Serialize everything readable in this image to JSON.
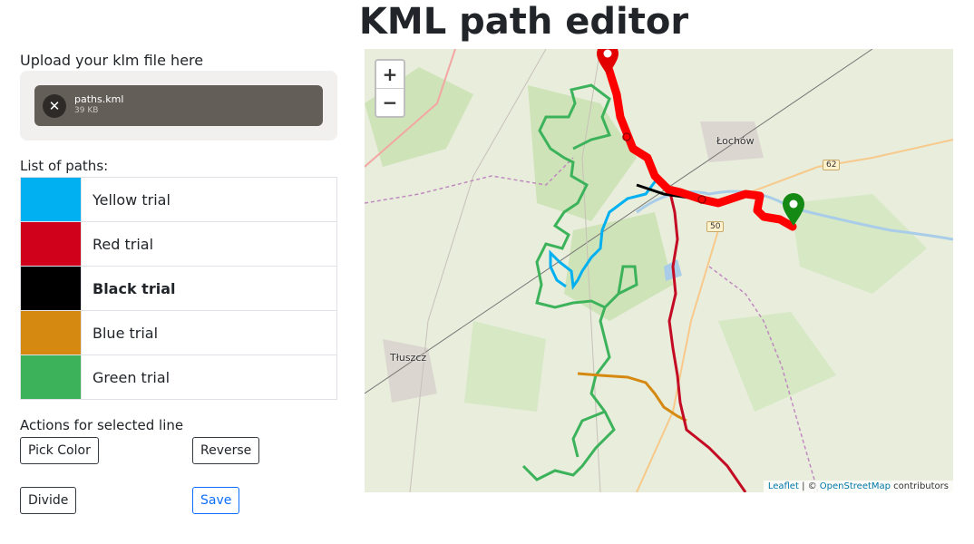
{
  "page": {
    "title": "KML path editor"
  },
  "upload": {
    "label": "Upload your klm file here",
    "file_name": "paths.kml",
    "file_size": "39 KB",
    "remove_glyph": "✕"
  },
  "paths": {
    "label": "List of paths:",
    "items": [
      {
        "name": "Yellow trial",
        "color": "#00b0f0",
        "selected": false
      },
      {
        "name": "Red trial",
        "color": "#d0021b",
        "selected": false
      },
      {
        "name": "Black trial",
        "color": "#000000",
        "selected": true
      },
      {
        "name": "Blue trial",
        "color": "#d68910",
        "selected": false
      },
      {
        "name": "Green trial",
        "color": "#3cb35b",
        "selected": false
      }
    ]
  },
  "actions": {
    "label": "Actions for selected line",
    "pick_color": "Pick Color",
    "reverse": "Reverse",
    "divide": "Divide",
    "save": "Save"
  },
  "map": {
    "zoom_in": "+",
    "zoom_out": "−",
    "places": {
      "lochow": "Łochów",
      "tluszcz": "Tłuszcz"
    },
    "roads": {
      "r62": "62",
      "r50": "50"
    },
    "attribution": {
      "leaflet": "Leaflet",
      "separator": " | © ",
      "osm": "OpenStreetMap",
      "suffix": " contributors"
    },
    "colors": {
      "start_marker": "#e20000",
      "end_marker": "#148a14"
    }
  }
}
